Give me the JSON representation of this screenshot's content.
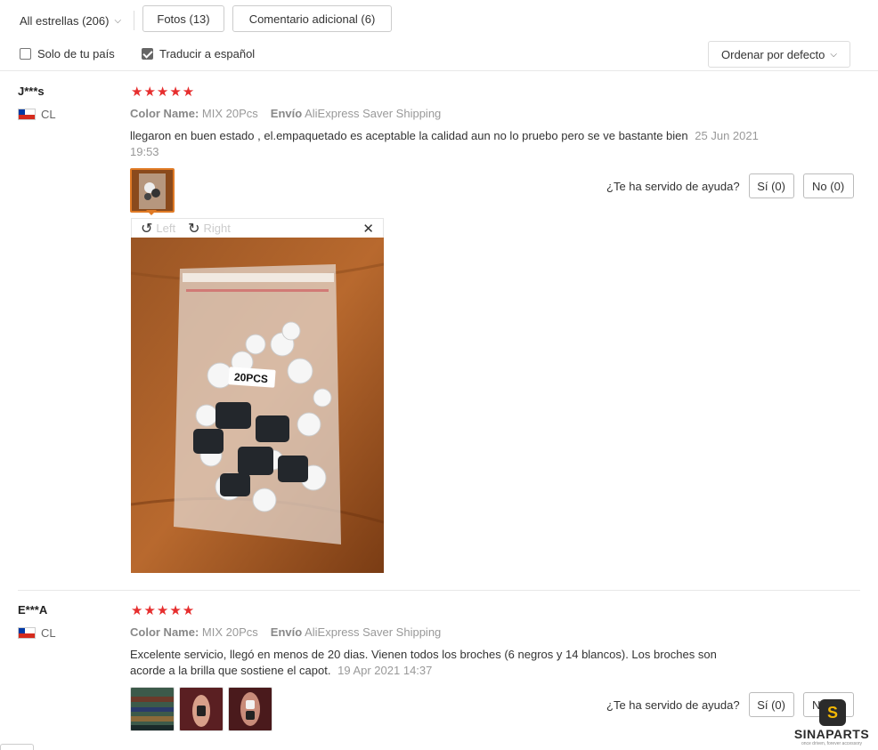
{
  "filters": {
    "stars_label": "All estrellas (206)",
    "fotos_label": "Fotos (13)",
    "comentario_label": "Comentario adicional (6)",
    "solo_pais_label": "Solo de tu país",
    "solo_pais_checked": false,
    "traducir_label": "Traducir a español",
    "traducir_checked": true,
    "sort_label": "Ordenar por defecto"
  },
  "helpful": {
    "question": "¿Te ha servido de ayuda?",
    "yes_label": "Sí (0)",
    "no_label": "No (0)"
  },
  "reviews": [
    {
      "user": "J***s",
      "country": "CL",
      "stars": "★★★★★",
      "rating": 5,
      "color_label": "Color Name:",
      "color_value": "MIX 20Pcs",
      "shipping_label": "Envío",
      "shipping_value": "AliExpress Saver Shipping",
      "text": "llegaron en buen estado , el.empaquetado es aceptable la calidad aun no lo pruebo pero se ve bastante bien",
      "date": "25 Jun 2021 19:53",
      "viewer": {
        "left_label": "Left",
        "right_label": "Right",
        "close_icon": "close-icon",
        "bag_label": "20PCS"
      }
    },
    {
      "user": "E***A",
      "country": "CL",
      "stars": "★★★★★",
      "rating": 5,
      "color_label": "Color Name:",
      "color_value": "MIX 20Pcs",
      "shipping_label": "Envío",
      "shipping_value": "AliExpress Saver Shipping",
      "text": "Excelente servicio, llegó en menos de 20 dias. Vienen todos los broches (6 negros y 14 blancos). Los broches son acorde a la brilla que sostiene el capot.",
      "date": "19 Apr 2021 14:37"
    }
  ],
  "watermark": {
    "brand": "SINAPARTS",
    "tagline": "once driven, forever accessory"
  },
  "colors": {
    "star": "#e62e2e",
    "thumb_active": "#e07a25",
    "logo_gold": "#f2b705"
  }
}
